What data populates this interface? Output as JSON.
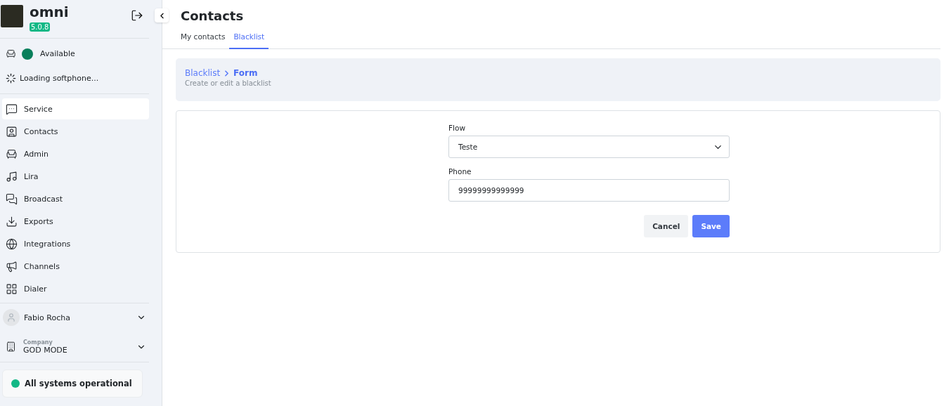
{
  "app": {
    "name": "omni",
    "version": "5.0.8"
  },
  "agent_status": {
    "label": "Available",
    "color": "#087f5b"
  },
  "softphone": {
    "label": "Loading softphone..."
  },
  "nav": [
    {
      "label": "Service",
      "selected": true
    },
    {
      "label": "Contacts",
      "selected": false
    },
    {
      "label": "Admin",
      "selected": false
    },
    {
      "label": "Lira",
      "selected": false
    },
    {
      "label": "Broadcast",
      "selected": false
    },
    {
      "label": "Exports",
      "selected": false
    },
    {
      "label": "Integrations",
      "selected": false
    },
    {
      "label": "Channels",
      "selected": false
    },
    {
      "label": "Dialer",
      "selected": false
    }
  ],
  "user": {
    "name": "Fabio Rocha"
  },
  "company": {
    "caption": "Company",
    "name": "GOD MODE"
  },
  "system_status": {
    "label": "All systems operational",
    "color": "#12b886"
  },
  "page": {
    "title": "Contacts"
  },
  "tabs": [
    {
      "label": "My contacts",
      "selected": false
    },
    {
      "label": "Blacklist",
      "selected": true
    }
  ],
  "breadcrumb": {
    "parent": "Blacklist",
    "current": "Form",
    "subtitle": "Create or edit a blacklist"
  },
  "form": {
    "fields": [
      {
        "kind": "select",
        "label": "Flow",
        "value": "Teste"
      },
      {
        "kind": "text",
        "label": "Phone",
        "value": "99999999999999"
      }
    ],
    "buttons": [
      {
        "label": "Cancel",
        "kind": "secondary"
      },
      {
        "label": "Save",
        "kind": "primary"
      }
    ]
  }
}
